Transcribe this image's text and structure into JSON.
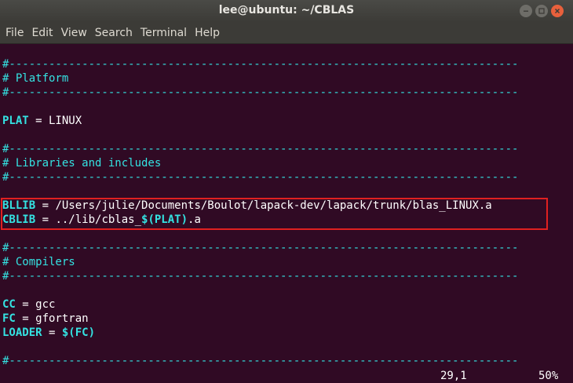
{
  "window": {
    "title": "lee@ubuntu: ~/CBLAS"
  },
  "menu": {
    "items": [
      "File",
      "Edit",
      "View",
      "Search",
      "Terminal",
      "Help"
    ]
  },
  "editor": {
    "rule": "#-----------------------------------------------------------------------------",
    "platform_comment": "# Platform",
    "plat_key": "PLAT",
    "plat_eq": " = LINUX",
    "libs_comment": "# Libraries and includes",
    "bllib_key": "BLLIB",
    "bllib_eq": " = /Users/julie/Documents/Boulot/lapack-dev/lapack/trunk/blas_LINUX.a",
    "cblib_key": "CBLIB",
    "cblib_eq": " = ../lib/cblas_",
    "cblib_var": "$(PLAT)",
    "cblib_ext": ".a",
    "compilers_comment": "# Compilers",
    "cc_key": "CC",
    "cc_eq": " = gcc",
    "fc_key": "FC",
    "fc_eq": " = gfortran",
    "loader_key": "LOADER",
    "loader_eq": " = ",
    "loader_var": "$(FC)"
  },
  "status": {
    "position": "29,1",
    "percent": "50%"
  }
}
